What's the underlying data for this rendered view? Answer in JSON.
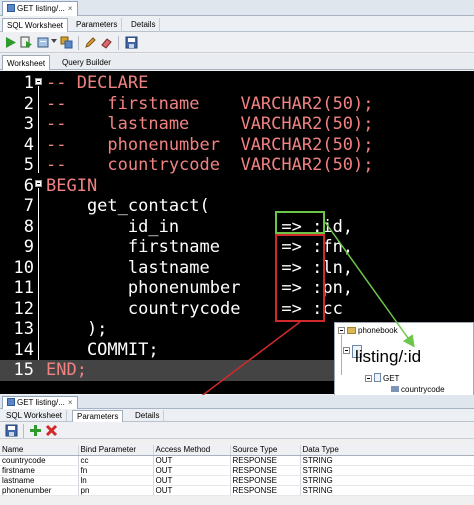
{
  "top_window": {
    "doc_tab_label": "GET listing/...",
    "doc_tab_close": "×",
    "subtabs": [
      "SQL Worksheet",
      "Parameters",
      "Details"
    ],
    "worksheet_tabs": [
      "Worksheet",
      "Query Builder"
    ]
  },
  "editor": {
    "lines": [
      {
        "num": "1",
        "text": "-- DECLARE"
      },
      {
        "num": "2",
        "text": "--    firstname    VARCHAR2(50);"
      },
      {
        "num": "3",
        "text": "--    lastname     VARCHAR2(50);"
      },
      {
        "num": "4",
        "text": "--    phonenumber  VARCHAR2(50);"
      },
      {
        "num": "5",
        "text": "--    countrycode  VARCHAR2(50);"
      },
      {
        "num": "6",
        "text": "BEGIN"
      },
      {
        "num": "7",
        "text": "    get_contact("
      },
      {
        "num": "8",
        "text": "        id_in          => :id,"
      },
      {
        "num": "9",
        "text": "        firstname      => :fn,"
      },
      {
        "num": "10",
        "text": "        lastname       => :ln,"
      },
      {
        "num": "11",
        "text": "        phonenumber    => :pn,"
      },
      {
        "num": "12",
        "text": "        countrycode    => :cc"
      },
      {
        "num": "13",
        "text": "    );"
      },
      {
        "num": "14",
        "text": "    COMMIT;"
      },
      {
        "num": "15",
        "text": "END;"
      }
    ]
  },
  "navigator": {
    "phonebook": "phonebook",
    "listing": "listing/:id",
    "get": "GET",
    "countrycode": "countrycode"
  },
  "bottom_window": {
    "doc_tab_label": "GET listing/...",
    "doc_tab_close": "×",
    "subtabs": [
      "SQL Worksheet",
      "Parameters",
      "Details"
    ],
    "table": {
      "headers": [
        "Name",
        "Bind Parameter",
        "Access Method",
        "Source Type",
        "Data Type"
      ],
      "rows": [
        [
          "countrycode",
          "cc",
          "OUT",
          "RESPONSE",
          "STRING"
        ],
        [
          "firstname",
          "fn",
          "OUT",
          "RESPONSE",
          "STRING"
        ],
        [
          "lastname",
          "ln",
          "OUT",
          "RESPONSE",
          "STRING"
        ],
        [
          "phonenumber",
          "pn",
          "OUT",
          "RESPONSE",
          "STRING"
        ]
      ]
    }
  },
  "colors": {
    "editor_bg": "#000000",
    "comment": "#f08282",
    "green_highlight": "#6cc64a",
    "red_highlight": "#d12a2a"
  }
}
